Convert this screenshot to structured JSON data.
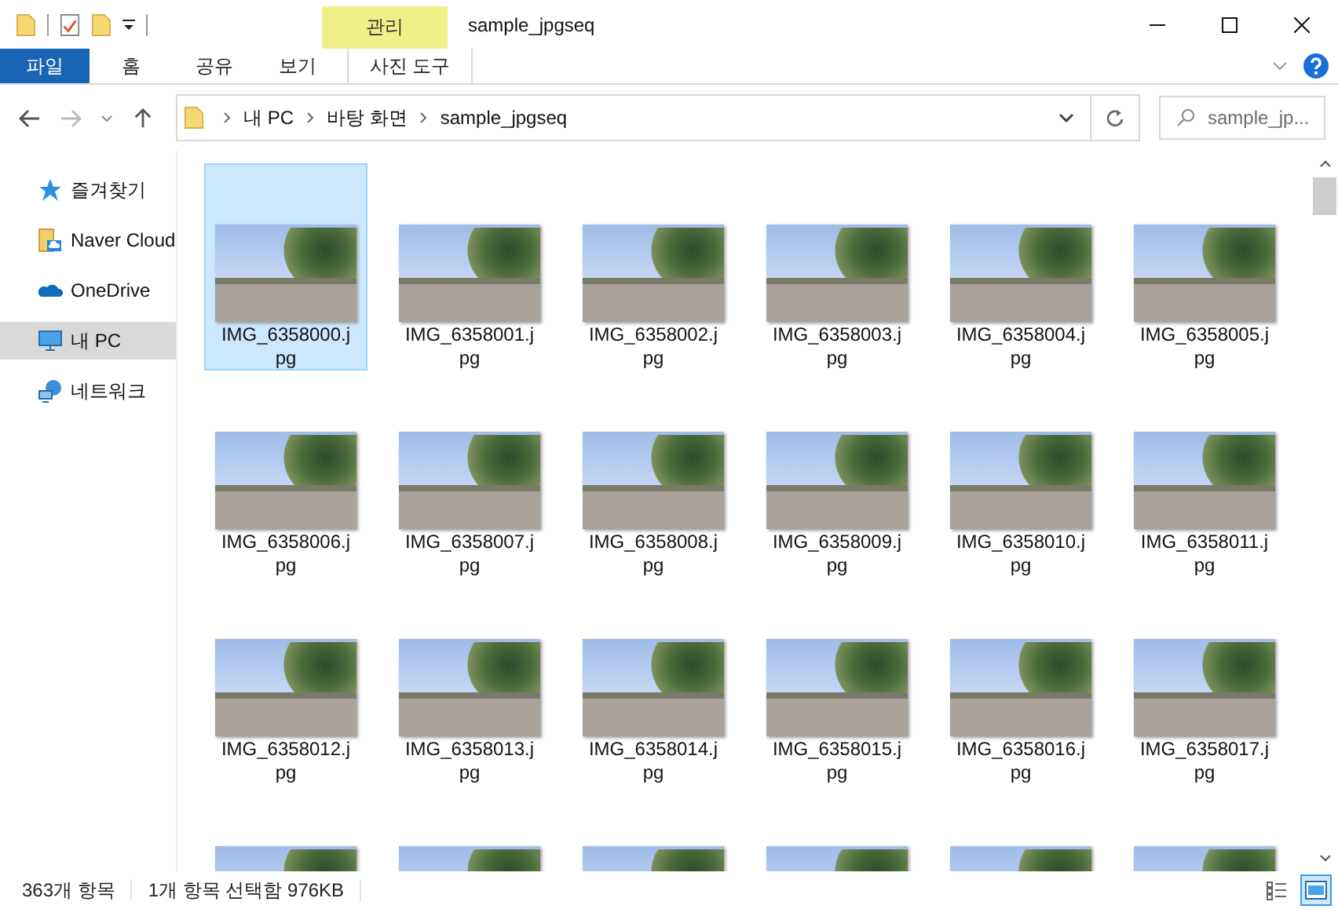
{
  "window": {
    "title": "sample_jpgseq",
    "context_tab_group": "관리"
  },
  "ribbon_tabs": [
    {
      "label": "파일",
      "kind": "file",
      "selected": false
    },
    {
      "label": "홈",
      "kind": "tab",
      "selected": false
    },
    {
      "label": "공유",
      "kind": "tab",
      "selected": false
    },
    {
      "label": "보기",
      "kind": "tab",
      "selected": false
    },
    {
      "label": "사진 도구",
      "kind": "context",
      "selected": false
    }
  ],
  "address": {
    "crumbs": [
      "내 PC",
      "바탕 화면",
      "sample_jpgseq"
    ]
  },
  "search": {
    "placeholder": "sample_jp..."
  },
  "sidebar": {
    "items": [
      {
        "label": "즐겨찾기",
        "kind": "star",
        "selected": false
      },
      {
        "label": "Naver Cloud",
        "kind": "cloudfolder",
        "selected": false
      },
      {
        "label": "OneDrive",
        "kind": "onedrive",
        "selected": false
      },
      {
        "label": "내 PC",
        "kind": "pc",
        "selected": true
      },
      {
        "label": "네트워크",
        "kind": "network",
        "selected": false
      }
    ]
  },
  "files": [
    {
      "name": "IMG_6358000.jpg",
      "selected": true
    },
    {
      "name": "IMG_6358001.jpg",
      "selected": false
    },
    {
      "name": "IMG_6358002.jpg",
      "selected": false
    },
    {
      "name": "IMG_6358003.jpg",
      "selected": false
    },
    {
      "name": "IMG_6358004.jpg",
      "selected": false
    },
    {
      "name": "IMG_6358005.jpg",
      "selected": false
    },
    {
      "name": "IMG_6358006.jpg",
      "selected": false
    },
    {
      "name": "IMG_6358007.jpg",
      "selected": false
    },
    {
      "name": "IMG_6358008.jpg",
      "selected": false
    },
    {
      "name": "IMG_6358009.jpg",
      "selected": false
    },
    {
      "name": "IMG_6358010.jpg",
      "selected": false
    },
    {
      "name": "IMG_6358011.jpg",
      "selected": false
    },
    {
      "name": "IMG_6358012.jpg",
      "selected": false
    },
    {
      "name": "IMG_6358013.jpg",
      "selected": false
    },
    {
      "name": "IMG_6358014.jpg",
      "selected": false
    },
    {
      "name": "IMG_6358015.jpg",
      "selected": false
    },
    {
      "name": "IMG_6358016.jpg",
      "selected": false
    },
    {
      "name": "IMG_6358017.jpg",
      "selected": false
    },
    {
      "selected": false
    },
    {
      "selected": false
    },
    {
      "selected": false
    },
    {
      "selected": false
    },
    {
      "selected": false
    },
    {
      "selected": false
    }
  ],
  "status_bar": {
    "item_count": "363개 항목",
    "selection": "1개 항목 선택함 976KB"
  }
}
